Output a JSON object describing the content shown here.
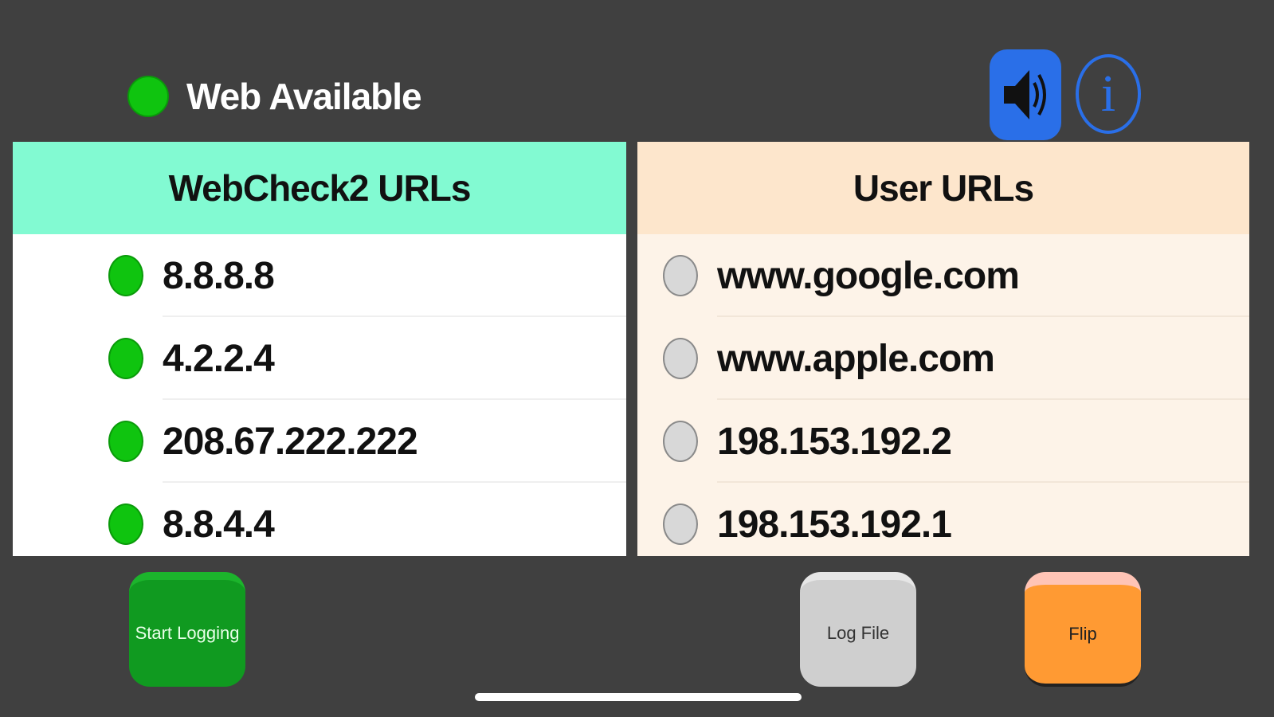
{
  "status": {
    "label": "Web Available",
    "state": "green"
  },
  "toolbar": {
    "sound_icon": "speaker-icon",
    "info_icon": "info-icon",
    "info_glyph": "i"
  },
  "webcheck": {
    "title": "WebCheck2 URLs",
    "items": [
      {
        "label": "8.8.8.8",
        "state": "green"
      },
      {
        "label": "4.2.2.4",
        "state": "green"
      },
      {
        "label": "208.67.222.222",
        "state": "green"
      },
      {
        "label": "8.8.4.4",
        "state": "green"
      }
    ]
  },
  "user": {
    "title": "User URLs",
    "items": [
      {
        "label": "www.google.com",
        "state": "gray"
      },
      {
        "label": "www.apple.com",
        "state": "gray"
      },
      {
        "label": "198.153.192.2",
        "state": "gray"
      },
      {
        "label": "198.153.192.1",
        "state": "gray"
      }
    ]
  },
  "buttons": {
    "start_logging": "Start Logging",
    "log_file": "Log File",
    "flip": "Flip"
  },
  "colors": {
    "background": "#404040",
    "webcheck_header": "#82fad2",
    "user_header": "#fde6cc",
    "status_green": "#0fc40f",
    "accent_blue": "#2a6fe8"
  }
}
